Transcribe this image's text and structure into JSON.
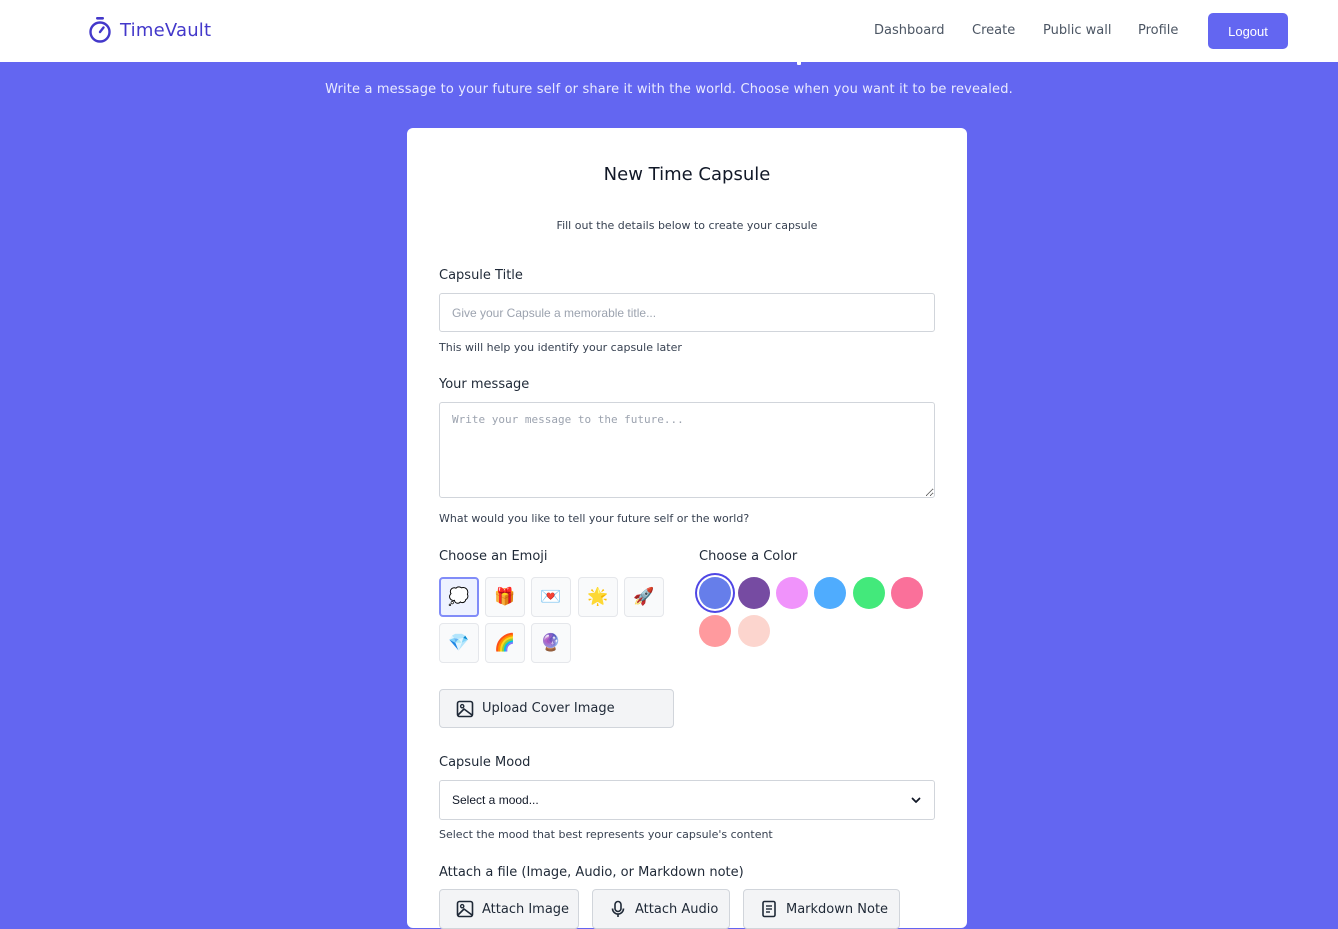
{
  "brand": {
    "name": "TimeVault",
    "icon": "stopwatch-icon",
    "color": "#4338ca"
  },
  "nav": {
    "links": [
      "Dashboard",
      "Create",
      "Public wall",
      "Profile"
    ],
    "logout_label": "Logout"
  },
  "hero": {
    "subtitle": "Write a message to your future self or share it with the world. Choose when you want it to be revealed."
  },
  "form": {
    "title": "New Time Capsule",
    "subtitle": "Fill out the details below to create your capsule",
    "capsule_title": {
      "label": "Capsule Title",
      "placeholder": "Give your Capsule a memorable title...",
      "value": "",
      "help": "This will help you identify your capsule later"
    },
    "message": {
      "label": "Your message",
      "placeholder": "Write your message to the future...",
      "value": "",
      "help": "What would you like to tell your future self or the world?"
    },
    "emoji": {
      "label": "Choose an Emoji",
      "options": [
        "💭",
        "🎁",
        "💌",
        "🌟",
        "🚀",
        "💎",
        "🌈",
        "🔮"
      ],
      "selected_index": 0
    },
    "color": {
      "label": "Choose a Color",
      "options": [
        "#667eea",
        "#764ba2",
        "#f093fb",
        "#4facfe",
        "#43e97b",
        "#fa709a",
        "#ff9a9e",
        "#fcd5ce"
      ],
      "selected_index": 0
    },
    "upload_cover": {
      "label": "Upload Cover Image",
      "icon": "image-icon"
    },
    "mood": {
      "label": "Capsule Mood",
      "selected": "Select a mood...",
      "help": "Select the mood that best represents your capsule's content"
    },
    "attach": {
      "label": "Attach a file (Image, Audio, or Markdown note)",
      "buttons": [
        {
          "label": "Attach Image",
          "icon": "image-icon"
        },
        {
          "label": "Attach Audio",
          "icon": "microphone-icon"
        },
        {
          "label": "Markdown Note",
          "icon": "note-icon"
        }
      ]
    }
  },
  "colors": {
    "accent": "#6366f1",
    "background": "#6366f1",
    "card": "#ffffff"
  }
}
